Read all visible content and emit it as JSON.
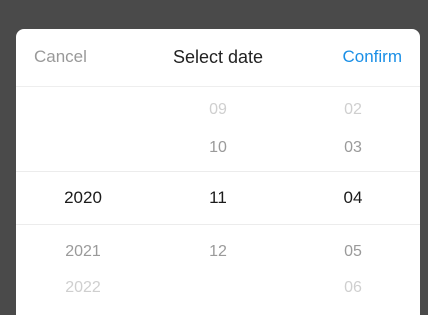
{
  "header": {
    "cancel_label": "Cancel",
    "title": "Select date",
    "confirm_label": "Confirm"
  },
  "picker": {
    "year": {
      "options": [
        "2020",
        "2021",
        "2022"
      ],
      "selected": "2020"
    },
    "month": {
      "options": [
        "09",
        "10",
        "11",
        "12"
      ],
      "selected": "11"
    },
    "day": {
      "options": [
        "02",
        "03",
        "04",
        "05",
        "06"
      ],
      "selected": "04"
    }
  },
  "colors": {
    "confirm": "#1a8fe6",
    "cancel": "#999999",
    "overlay": "#4a4a4a"
  }
}
